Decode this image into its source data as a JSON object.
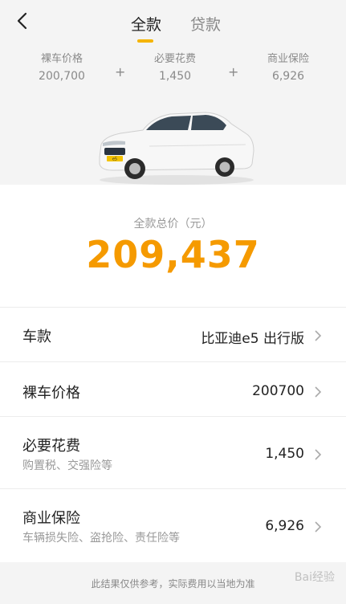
{
  "header": {
    "tabs": [
      {
        "label": "全款",
        "active": true
      },
      {
        "label": "贷款",
        "active": false
      }
    ]
  },
  "summary": {
    "items": [
      {
        "label": "裸车价格",
        "value": "200,700"
      },
      {
        "label": "必要花费",
        "value": "1,450"
      },
      {
        "label": "商业保险",
        "value": "6,926"
      }
    ],
    "plus": "+"
  },
  "car": {
    "plate": "e5"
  },
  "total": {
    "label": "全款总价（元）",
    "value": "209,437"
  },
  "rows": [
    {
      "title": "车款",
      "subtitle": "",
      "value": "比亚迪e5 出行版"
    },
    {
      "title": "裸车价格",
      "subtitle": "",
      "value": "200700"
    },
    {
      "title": "必要花费",
      "subtitle": "购置税、交强险等",
      "value": "1,450"
    },
    {
      "title": "商业保险",
      "subtitle": "车辆损失险、盗抢险、责任险等",
      "value": "6,926"
    }
  ],
  "footer": {
    "note": "此结果仅供参考，实际费用以当地为准",
    "watermark": "Bai经验"
  },
  "colors": {
    "accent": "#f5b400",
    "total": "#f59a00"
  }
}
